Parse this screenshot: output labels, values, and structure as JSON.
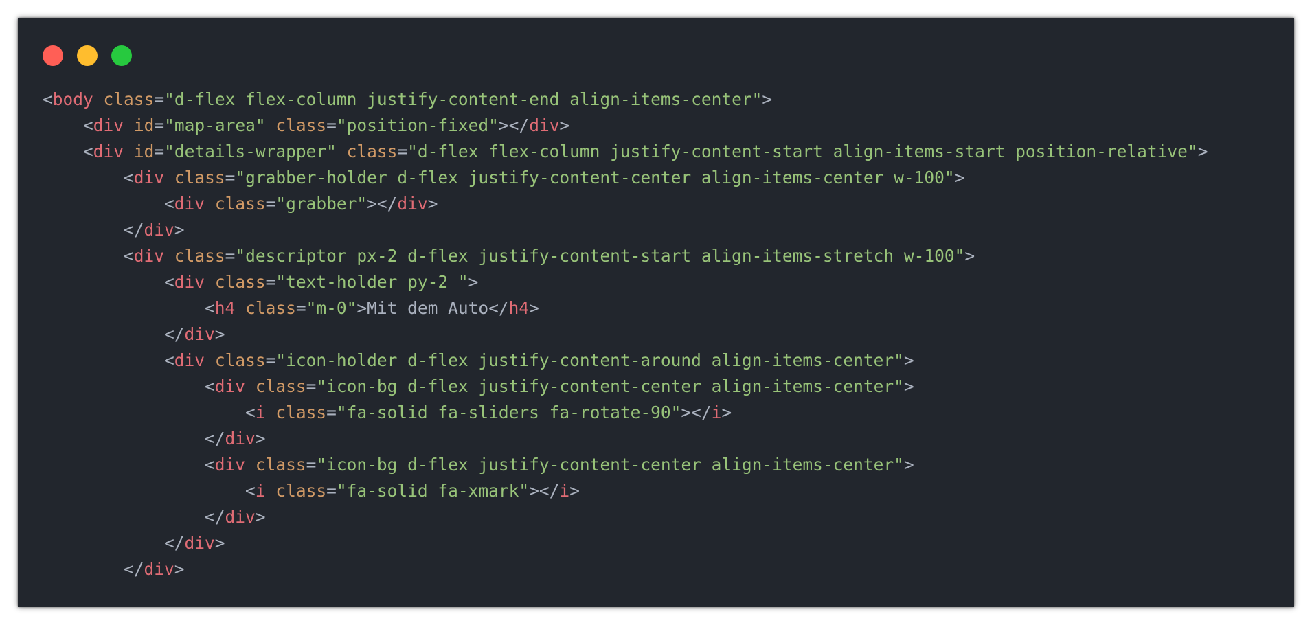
{
  "window_controls": [
    {
      "name": "close",
      "color": "#ff5f56"
    },
    {
      "name": "minimize",
      "color": "#ffbd2e"
    },
    {
      "name": "zoom",
      "color": "#27c93f"
    }
  ],
  "colors": {
    "background": "#22262d",
    "tag": "#e06c75",
    "attribute": "#d19a66",
    "string": "#98c379",
    "punctuation": "#abb2bf"
  },
  "code_lines": [
    {
      "indent": 0,
      "tokens": [
        [
          "p",
          "<"
        ],
        [
          "t",
          "body"
        ],
        [
          "p",
          " "
        ],
        [
          "a",
          "class"
        ],
        [
          "p",
          "="
        ],
        [
          "v",
          "\"d-flex flex-column justify-content-end align-items-center\""
        ],
        [
          "p",
          ">"
        ]
      ]
    },
    {
      "indent": 1,
      "tokens": [
        [
          "p",
          "<"
        ],
        [
          "t",
          "div"
        ],
        [
          "p",
          " "
        ],
        [
          "a",
          "id"
        ],
        [
          "p",
          "="
        ],
        [
          "v",
          "\"map-area\""
        ],
        [
          "p",
          " "
        ],
        [
          "a",
          "class"
        ],
        [
          "p",
          "="
        ],
        [
          "v",
          "\"position-fixed\""
        ],
        [
          "p",
          "></"
        ],
        [
          "t",
          "div"
        ],
        [
          "p",
          ">"
        ]
      ]
    },
    {
      "indent": 1,
      "tokens": [
        [
          "p",
          "<"
        ],
        [
          "t",
          "div"
        ],
        [
          "p",
          " "
        ],
        [
          "a",
          "id"
        ],
        [
          "p",
          "="
        ],
        [
          "v",
          "\"details-wrapper\""
        ],
        [
          "p",
          " "
        ],
        [
          "a",
          "class"
        ],
        [
          "p",
          "="
        ],
        [
          "v",
          "\"d-flex flex-column justify-content-start align-items-start position-relative\""
        ],
        [
          "p",
          ">"
        ]
      ]
    },
    {
      "indent": 2,
      "tokens": [
        [
          "p",
          "<"
        ],
        [
          "t",
          "div"
        ],
        [
          "p",
          " "
        ],
        [
          "a",
          "class"
        ],
        [
          "p",
          "="
        ],
        [
          "v",
          "\"grabber-holder d-flex justify-content-center align-items-center w-100\""
        ],
        [
          "p",
          ">"
        ]
      ]
    },
    {
      "indent": 3,
      "tokens": [
        [
          "p",
          "<"
        ],
        [
          "t",
          "div"
        ],
        [
          "p",
          " "
        ],
        [
          "a",
          "class"
        ],
        [
          "p",
          "="
        ],
        [
          "v",
          "\"grabber\""
        ],
        [
          "p",
          "></"
        ],
        [
          "t",
          "div"
        ],
        [
          "p",
          ">"
        ]
      ]
    },
    {
      "indent": 2,
      "tokens": [
        [
          "p",
          "</"
        ],
        [
          "t",
          "div"
        ],
        [
          "p",
          ">"
        ]
      ]
    },
    {
      "indent": 2,
      "tokens": [
        [
          "p",
          "<"
        ],
        [
          "t",
          "div"
        ],
        [
          "p",
          " "
        ],
        [
          "a",
          "class"
        ],
        [
          "p",
          "="
        ],
        [
          "v",
          "\"descriptor px-2 d-flex justify-content-start align-items-stretch w-100\""
        ],
        [
          "p",
          ">"
        ]
      ]
    },
    {
      "indent": 3,
      "tokens": [
        [
          "p",
          "<"
        ],
        [
          "t",
          "div"
        ],
        [
          "p",
          " "
        ],
        [
          "a",
          "class"
        ],
        [
          "p",
          "="
        ],
        [
          "v",
          "\"text-holder py-2 \""
        ],
        [
          "p",
          ">"
        ]
      ]
    },
    {
      "indent": 4,
      "tokens": [
        [
          "p",
          "<"
        ],
        [
          "t",
          "h4"
        ],
        [
          "p",
          " "
        ],
        [
          "a",
          "class"
        ],
        [
          "p",
          "="
        ],
        [
          "v",
          "\"m-0\""
        ],
        [
          "p",
          ">"
        ],
        [
          "x",
          "Mit dem Auto"
        ],
        [
          "p",
          "</"
        ],
        [
          "t",
          "h4"
        ],
        [
          "p",
          ">"
        ]
      ]
    },
    {
      "indent": 3,
      "tokens": [
        [
          "p",
          "</"
        ],
        [
          "t",
          "div"
        ],
        [
          "p",
          ">"
        ]
      ]
    },
    {
      "indent": 3,
      "tokens": [
        [
          "p",
          "<"
        ],
        [
          "t",
          "div"
        ],
        [
          "p",
          " "
        ],
        [
          "a",
          "class"
        ],
        [
          "p",
          "="
        ],
        [
          "v",
          "\"icon-holder d-flex justify-content-around align-items-center\""
        ],
        [
          "p",
          ">"
        ]
      ]
    },
    {
      "indent": 4,
      "tokens": [
        [
          "p",
          "<"
        ],
        [
          "t",
          "div"
        ],
        [
          "p",
          " "
        ],
        [
          "a",
          "class"
        ],
        [
          "p",
          "="
        ],
        [
          "v",
          "\"icon-bg d-flex justify-content-center align-items-center\""
        ],
        [
          "p",
          ">"
        ]
      ]
    },
    {
      "indent": 5,
      "tokens": [
        [
          "p",
          "<"
        ],
        [
          "t",
          "i"
        ],
        [
          "p",
          " "
        ],
        [
          "a",
          "class"
        ],
        [
          "p",
          "="
        ],
        [
          "v",
          "\"fa-solid fa-sliders fa-rotate-90\""
        ],
        [
          "p",
          "></"
        ],
        [
          "t",
          "i"
        ],
        [
          "p",
          ">"
        ]
      ]
    },
    {
      "indent": 4,
      "tokens": [
        [
          "p",
          "</"
        ],
        [
          "t",
          "div"
        ],
        [
          "p",
          ">"
        ]
      ]
    },
    {
      "indent": 4,
      "tokens": [
        [
          "p",
          "<"
        ],
        [
          "t",
          "div"
        ],
        [
          "p",
          " "
        ],
        [
          "a",
          "class"
        ],
        [
          "p",
          "="
        ],
        [
          "v",
          "\"icon-bg d-flex justify-content-center align-items-center\""
        ],
        [
          "p",
          ">"
        ]
      ]
    },
    {
      "indent": 5,
      "tokens": [
        [
          "p",
          "<"
        ],
        [
          "t",
          "i"
        ],
        [
          "p",
          " "
        ],
        [
          "a",
          "class"
        ],
        [
          "p",
          "="
        ],
        [
          "v",
          "\"fa-solid fa-xmark\""
        ],
        [
          "p",
          "></"
        ],
        [
          "t",
          "i"
        ],
        [
          "p",
          ">"
        ]
      ]
    },
    {
      "indent": 4,
      "tokens": [
        [
          "p",
          "</"
        ],
        [
          "t",
          "div"
        ],
        [
          "p",
          ">"
        ]
      ]
    },
    {
      "indent": 3,
      "tokens": [
        [
          "p",
          "</"
        ],
        [
          "t",
          "div"
        ],
        [
          "p",
          ">"
        ]
      ]
    },
    {
      "indent": 2,
      "tokens": [
        [
          "p",
          "</"
        ],
        [
          "t",
          "div"
        ],
        [
          "p",
          ">"
        ]
      ]
    }
  ]
}
